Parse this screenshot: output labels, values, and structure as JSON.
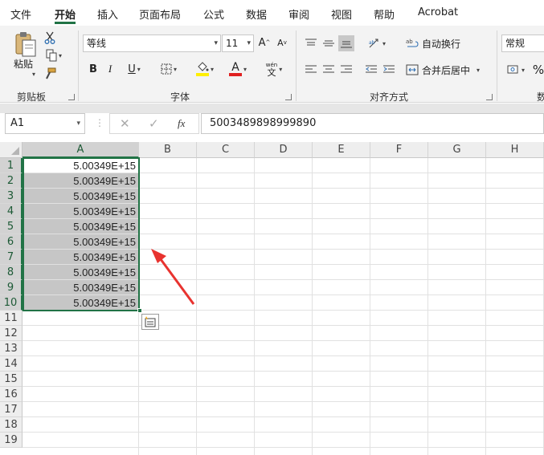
{
  "menu": {
    "tabs": [
      "文件",
      "开始",
      "插入",
      "页面布局",
      "公式",
      "数据",
      "审阅",
      "视图",
      "帮助",
      "Acrobat"
    ],
    "active": "开始"
  },
  "ribbon": {
    "clipboard": {
      "paste_label": "粘贴",
      "group_label": "剪贴板"
    },
    "font": {
      "font_name": "等线",
      "font_size": "11",
      "grow_label": "A",
      "shrink_label": "A",
      "bold": "B",
      "italic": "I",
      "underline": "U",
      "font_color_label": "A",
      "phonetic_label": "wén",
      "phonetic_char": "文",
      "group_label": "字体"
    },
    "alignment": {
      "wrap_text": "自动换行",
      "merge_center": "合并后居中",
      "group_label": "对齐方式"
    },
    "number": {
      "format": "常规",
      "percent": "%",
      "group_label_partial": "数"
    }
  },
  "formula_bar": {
    "name_box": "A1",
    "fx_label": "fx",
    "formula_value": "5003489898999890"
  },
  "sheet": {
    "columns": [
      "A",
      "B",
      "C",
      "D",
      "E",
      "F",
      "G",
      "H"
    ],
    "rows": [
      "1",
      "2",
      "3",
      "4",
      "5",
      "6",
      "7",
      "8",
      "9",
      "10",
      "11",
      "12",
      "13",
      "14",
      "15",
      "16",
      "17",
      "18",
      "19"
    ],
    "a_values": [
      "5.00349E+15",
      "5.00349E+15",
      "5.00349E+15",
      "5.00349E+15",
      "5.00349E+15",
      "5.00349E+15",
      "5.00349E+15",
      "5.00349E+15",
      "5.00349E+15",
      "5.00349E+15"
    ],
    "selected_range": "A1:A10",
    "active_cell": "A1"
  },
  "colors": {
    "accent": "#217346",
    "selection_fill": "#c6c6c6",
    "annotation_arrow": "#e8332f",
    "font_color_bar": "#e02020",
    "highlight_bar": "#ffef00"
  }
}
